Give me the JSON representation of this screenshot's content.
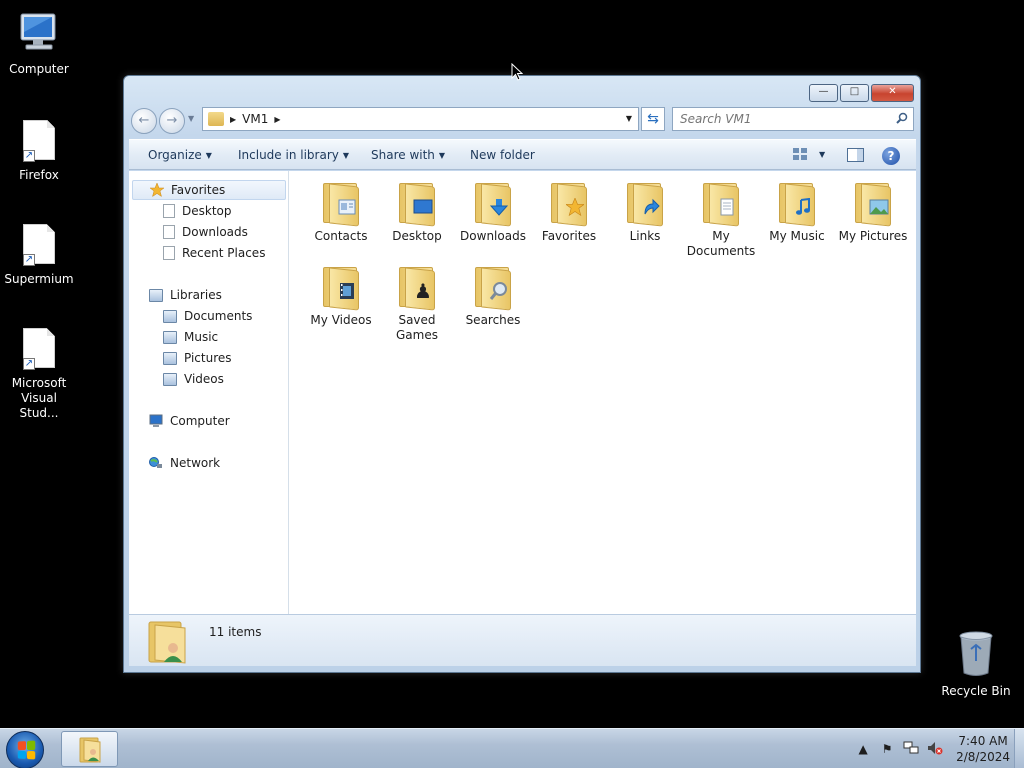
{
  "desktop": {
    "icons": [
      {
        "label": "Computer"
      },
      {
        "label": "Firefox"
      },
      {
        "label": "Supermium"
      },
      {
        "label": "Microsoft Visual Stud..."
      }
    ],
    "recycle_bin": {
      "label": "Recycle Bin"
    }
  },
  "window": {
    "caption": {
      "minimize": "—",
      "maximize": "□",
      "close": "✕"
    },
    "address": {
      "path": [
        "VM1"
      ]
    },
    "search": {
      "placeholder": "Search VM1"
    },
    "toolbar": {
      "organize": "Organize",
      "include_in_library": "Include in library",
      "share_with": "Share with",
      "new_folder": "New folder"
    },
    "nav": {
      "favorites": "Favorites",
      "favorites_items": [
        "Desktop",
        "Downloads",
        "Recent Places"
      ],
      "libraries": "Libraries",
      "libraries_items": [
        "Documents",
        "Music",
        "Pictures",
        "Videos"
      ],
      "computer": "Computer",
      "network": "Network"
    },
    "files": [
      {
        "name": "Contacts",
        "icon": "contacts-icon"
      },
      {
        "name": "Desktop",
        "icon": "desktop-icon"
      },
      {
        "name": "Downloads",
        "icon": "downloads-icon"
      },
      {
        "name": "Favorites",
        "icon": "star-icon"
      },
      {
        "name": "Links",
        "icon": "link-arrow-icon"
      },
      {
        "name": "My Documents",
        "icon": "documents-icon"
      },
      {
        "name": "My Music",
        "icon": "music-note-icon"
      },
      {
        "name": "My Pictures",
        "icon": "picture-icon"
      },
      {
        "name": "My Videos",
        "icon": "film-icon"
      },
      {
        "name": "Saved Games",
        "icon": "chess-piece-icon"
      },
      {
        "name": "Searches",
        "icon": "magnifier-icon"
      }
    ],
    "details": {
      "item_count": "11 items"
    }
  },
  "taskbar": {
    "clock": {
      "time": "7:40 AM",
      "date": "2/8/2024"
    }
  },
  "colors": {
    "desktop_bg": "#000000",
    "accent": "#1e4ea8",
    "folder": "#f0d27c"
  }
}
